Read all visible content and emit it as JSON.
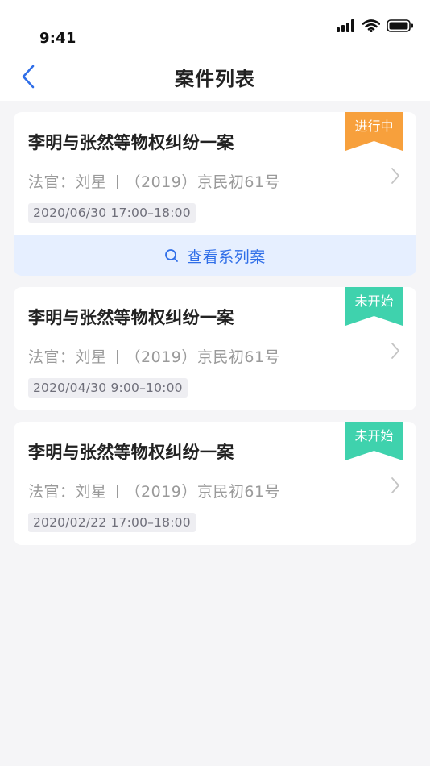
{
  "status_bar": {
    "time": "9:41",
    "icons": [
      "signal-icon",
      "wifi-icon",
      "battery-icon"
    ]
  },
  "nav": {
    "back_icon": "chevron-left-icon",
    "title": "案件列表"
  },
  "colors": {
    "accent": "#2f6ee8",
    "status_in_progress": "#f7a03c",
    "status_not_started": "#3fd2ad"
  },
  "cases": [
    {
      "title": "李明与张然等物权纠纷一案",
      "judge_label": "法官：",
      "judge": "刘星",
      "case_no": "（2019）京民初61号",
      "time": "2020/06/30  17:00–18:00",
      "status": "进行中",
      "series_button": "查看系列案"
    },
    {
      "title": "李明与张然等物权纠纷一案",
      "judge_label": "法官：",
      "judge": "刘星",
      "case_no": "（2019）京民初61号",
      "time": "2020/04/30  9:00–10:00",
      "status": "未开始"
    },
    {
      "title": "李明与张然等物权纠纷一案",
      "judge_label": "法官：",
      "judge": "刘星",
      "case_no": "（2019）京民初61号",
      "time": "2020/02/22 17:00–18:00",
      "status": "未开始"
    }
  ]
}
